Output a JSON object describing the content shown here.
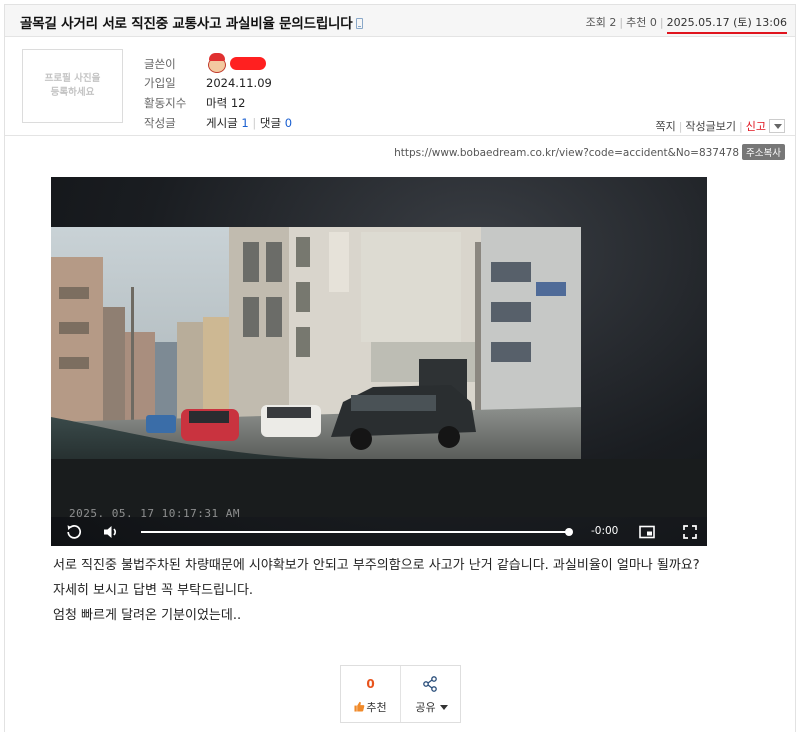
{
  "post": {
    "title": "골목길 사거리 서로 직진중 교통사고 과실비율 문의드립니다",
    "views": "조회 2",
    "recommends": "추천 0",
    "date": "2025.05.17 (토) 13:06"
  },
  "author": {
    "photo_placeholder_line1": "프로필 사진을",
    "photo_placeholder_line2": "등록하세요",
    "label_writer": "글쓴이",
    "label_joined": "가입일",
    "joined": "2024.11.09",
    "label_activity": "활동지수",
    "activity": "마력 12",
    "label_posts": "작성글",
    "posts_label": "게시글",
    "posts_count": "1",
    "comments_label": "댓글",
    "comments_count": "0"
  },
  "actions": {
    "message": "쪽지",
    "view_posts": "작성글보기",
    "report": "신고"
  },
  "url": {
    "text": "https://www.bobaedream.co.kr/view?code=accident&No=837478",
    "copy_label": "주소복사"
  },
  "video": {
    "timestamp": "2025. 05. 17 10:17:31 AM",
    "time_left": "-0:00",
    "progress": 1.0
  },
  "body": {
    "line1": "서로 직진중 불법주차된 차량때문에 시야확보가 안되고 부주의함으로 사고가 난거 같습니다. 과실비율이 얼마나 될까요?",
    "line2": "자세히 보시고 답변 꼭 부탁드립니다.",
    "line3": "엄청 빠르게 달려온 기분이었는데.."
  },
  "recommend": {
    "count": "0",
    "label": "추천",
    "share_label": "공유"
  },
  "colors": {
    "accent_red": "#e0141e",
    "link_blue": "#1a5fd0",
    "recommend_orange": "#e8531c"
  }
}
